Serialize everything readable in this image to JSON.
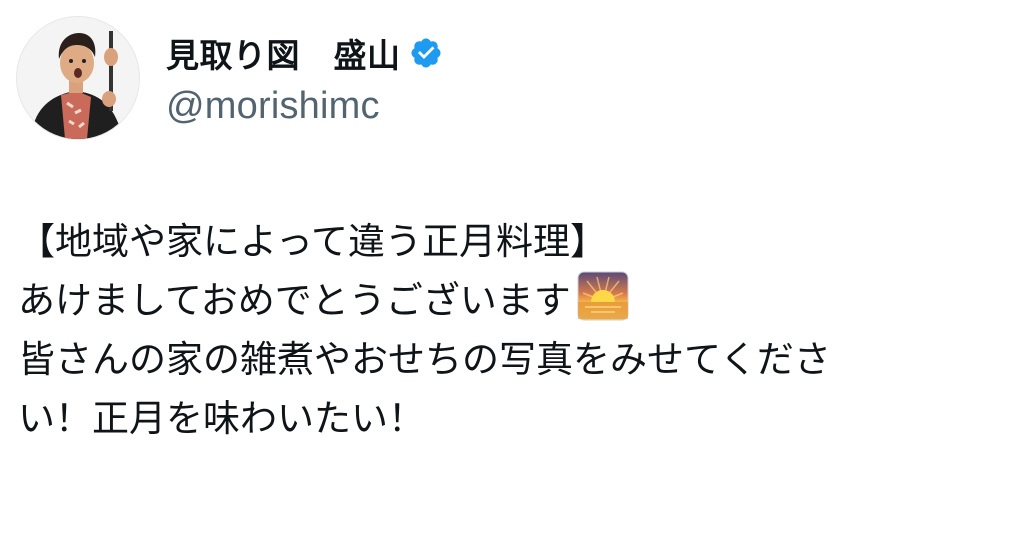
{
  "user": {
    "display_name": "見取り図　盛山",
    "handle": "@morishimc",
    "verified_icon": "verified-badge-icon",
    "avatar_icon": "profile-avatar"
  },
  "tweet": {
    "lines": [
      "【地域や家によって違う正月料理】",
      "あけましておめでとうございます",
      "皆さんの家の雑煮やおせちの写真をみせてくださ",
      "い！正月を味わいたい！"
    ],
    "emoji": "sunrise-emoji-icon"
  },
  "colors": {
    "text": "#0f1419",
    "handle": "#536471",
    "verified": "#1d9bf0"
  }
}
